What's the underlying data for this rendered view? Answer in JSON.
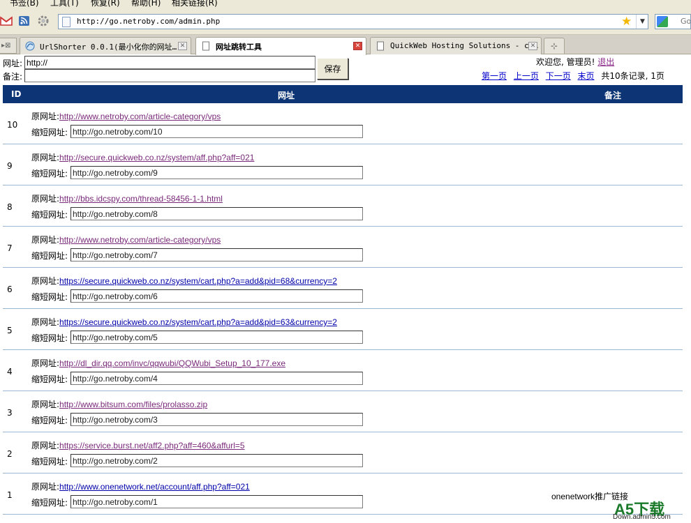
{
  "menu": [
    "书签(B)",
    "工具(T)",
    "恢复(R)",
    "帮助(H)",
    "相关链接(R)"
  ],
  "browser": {
    "url": "http://go.netroby.com/admin.php",
    "search_placeholder": "Go"
  },
  "tabs": [
    {
      "label": "UrlShorter 0.0.1(最小化你的网址…"
    },
    {
      "label": "网址跳转工具",
      "active": true
    },
    {
      "label": "QuickWeb Hosting Solutions - cP…"
    }
  ],
  "form": {
    "url_label": "网址:",
    "url_value": "http://",
    "note_label": "备注:",
    "note_value": "",
    "save_label": "保存"
  },
  "header": {
    "welcome": "欢迎您, 管理员!",
    "logout": "退出"
  },
  "pager": {
    "first": "第一页",
    "prev": "上一页",
    "next": "下一页",
    "last": "末页",
    "summary": "共10条记录, 1页"
  },
  "table": {
    "columns": {
      "id": "ID",
      "url": "网址",
      "note": "备注"
    },
    "orig_label": "原网址:",
    "short_label": "缩短网址:",
    "rows": [
      {
        "id": "10",
        "orig": "http://www.netroby.com/article-category/vps",
        "short": "http://go.netroby.com/10",
        "note": ""
      },
      {
        "id": "9",
        "orig": "http://secure.quickweb.co.nz/system/aff.php?aff=021",
        "short": "http://go.netroby.com/9",
        "note": ""
      },
      {
        "id": "8",
        "orig": "http://bbs.idcspy.com/thread-58456-1-1.html",
        "short": "http://go.netroby.com/8",
        "note": ""
      },
      {
        "id": "7",
        "orig": "http://www.netroby.com/article-category/vps",
        "short": "http://go.netroby.com/7",
        "note": ""
      },
      {
        "id": "6",
        "orig": "https://secure.quickweb.co.nz/system/cart.php?a=add&pid=68&currency=2",
        "short": "http://go.netroby.com/6",
        "note": ""
      },
      {
        "id": "5",
        "orig": "https://secure.quickweb.co.nz/system/cart.php?a=add&pid=63&currency=2",
        "short": "http://go.netroby.com/5",
        "note": ""
      },
      {
        "id": "4",
        "orig": "http://dl_dir.qq.com/invc/qqwubi/QQWubi_Setup_10_177.exe",
        "short": "http://go.netroby.com/4",
        "note": ""
      },
      {
        "id": "3",
        "orig": "http://www.bitsum.com/files/prolasso.zip",
        "short": "http://go.netroby.com/3",
        "note": ""
      },
      {
        "id": "2",
        "orig": "https://service.burst.net/aff2.php?aff=460&affurl=5",
        "short": "http://go.netroby.com/2",
        "note": ""
      },
      {
        "id": "1",
        "orig": "http://www.onenetwork.net/account/aff.php?aff=021",
        "short": "http://go.netroby.com/1",
        "note": "onenetwork推广链接"
      }
    ]
  },
  "watermark": {
    "brand": "A5下载",
    "site": "Down.admin5.com"
  },
  "colors": {
    "header_bg": "#0d3474",
    "row_divider": "#9bb7d4",
    "visited_link": "#7a2a7a",
    "link": "#0000aa"
  }
}
